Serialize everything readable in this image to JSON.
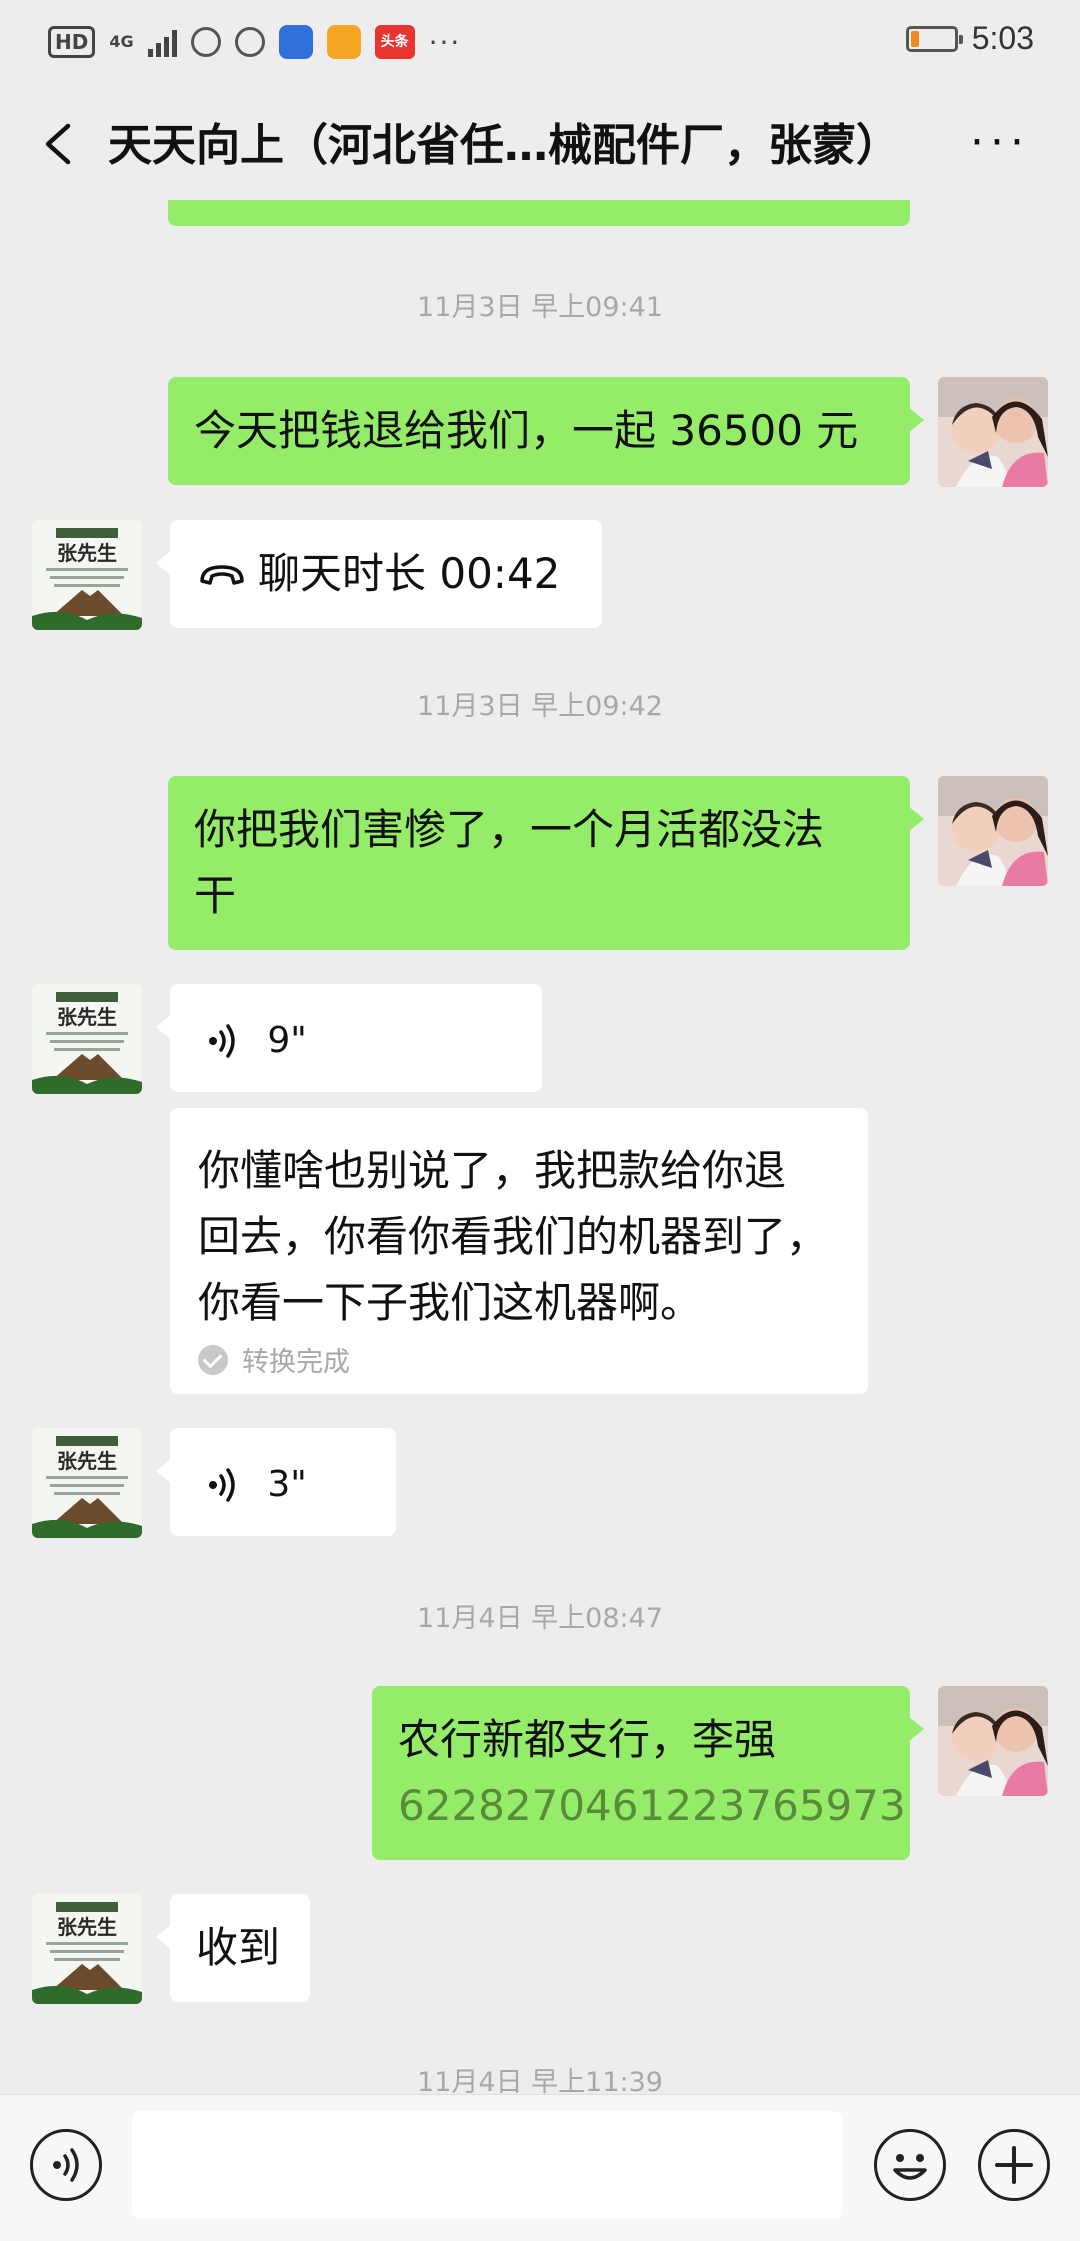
{
  "status_bar": {
    "hd": "HD",
    "network": "4G",
    "toutiao": "头条",
    "more": "···",
    "time": "5:03",
    "battery_level": 0.2,
    "battery_color": "#f08a1a"
  },
  "header": {
    "title": "天天向上（河北省任…械配件厂，张蒙）",
    "more_icon": "···"
  },
  "messages": {
    "ts1": "11月3日 早上09:41",
    "m1": "今天把钱退给我们，一起 36500 元",
    "m2_call": "聊天时长 00:42",
    "ts2": "11月3日 早上09:42",
    "m3_line1": "你把我们害惨了，一个月活都没法",
    "m3_line2": "干",
    "m4_voice": "9\"",
    "m4_transcript_l1": "你懂啥也别说了，我把款给你退",
    "m4_transcript_l2": "回去，你看你看我们的机器到了，",
    "m4_transcript_l3": "你看一下子我们这机器啊。",
    "m4_status": "转换完成",
    "m5_voice": "3\"",
    "ts3": "11月4日 早上08:47",
    "m6_line1": "农行新都支行，李强",
    "m6_account": "6228270461223765973",
    "m7": "收到",
    "ts4": "11月4日 早上11:39"
  },
  "contact_avatar": {
    "name": "张先生"
  },
  "colors": {
    "outgoing_bubble": "#95ec69",
    "incoming_bubble": "#ffffff",
    "background": "#ededed",
    "timestamp": "#a8a8a8"
  }
}
